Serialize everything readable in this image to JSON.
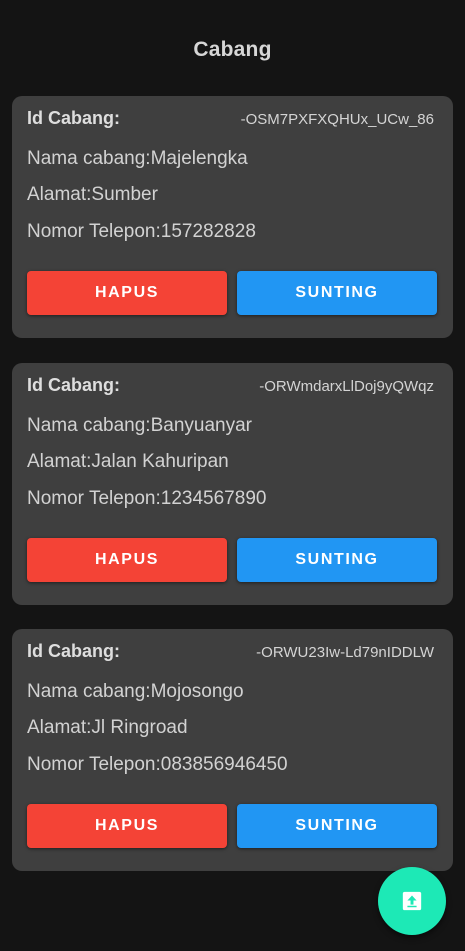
{
  "header": {
    "title": "Cabang"
  },
  "branches": [
    {
      "id_label": "Id Cabang:",
      "id_value": "-OSM7PXFXQHUx_UCw_86",
      "name_text": "Nama cabang:Majelengka",
      "address_text": "Alamat:Sumber",
      "phone_text": "Nomor Telepon:157282828",
      "delete_label": "HAPUS",
      "edit_label": "SUNTING"
    },
    {
      "id_label": "Id Cabang:",
      "id_value": "-ORWmdarxLlDoj9yQWqz",
      "name_text": "Nama cabang:Banyuanyar",
      "address_text": "Alamat:Jalan Kahuripan",
      "phone_text": "Nomor Telepon:1234567890",
      "delete_label": "HAPUS",
      "edit_label": "SUNTING"
    },
    {
      "id_label": "Id Cabang:",
      "id_value": "-ORWU23Iw-Ld79nIDDLW",
      "name_text": "Nama cabang:Mojosongo",
      "address_text": "Alamat:Jl Ringroad",
      "phone_text": "Nomor Telepon:083856946450",
      "delete_label": "HAPUS",
      "edit_label": "SUNTING"
    }
  ],
  "fab": {
    "icon": "upload-icon"
  },
  "colors": {
    "background": "#141414",
    "card": "#3f3f3f",
    "delete_button": "#f44336",
    "edit_button": "#2196f3",
    "fab": "#1de9b6"
  }
}
